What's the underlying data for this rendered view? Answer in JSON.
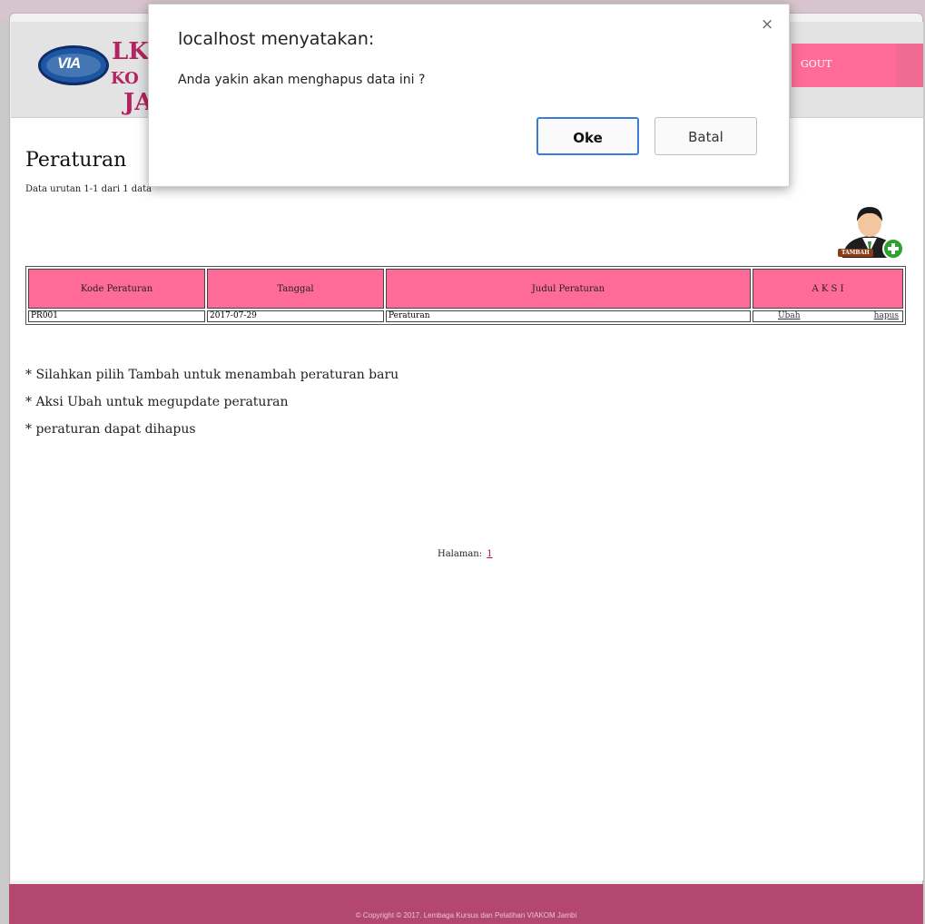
{
  "header": {
    "logo_text": "VIA",
    "brand_line1": "LK",
    "brand_line2": "KO",
    "brand_line3": "JA",
    "logout_label": "GOUT"
  },
  "page": {
    "title": "Peraturan",
    "data_info": "Data urutan 1-1 dari 1 data",
    "add_label": "TAMBAH"
  },
  "table": {
    "headers": [
      "Kode Peraturan",
      "Tanggal",
      "Judul Peraturan",
      "A K S I"
    ],
    "rows": [
      {
        "kode": "PR001",
        "tanggal": "2017-07-29",
        "judul": "Peraturan",
        "ubah": "Ubah",
        "hapus": "hapus"
      }
    ]
  },
  "notes": [
    "* Silahkan pilih Tambah untuk menambah peraturan baru",
    "* Aksi Ubah untuk megupdate peraturan",
    "* peraturan dapat dihapus"
  ],
  "pagination": {
    "label": "Halaman:",
    "current": "1"
  },
  "footer": {
    "text": "© Copyright © 2017. Lembaga Kursus dan Pelatihan VIAKOM Jambi"
  },
  "dialog": {
    "title": "localhost menyatakan:",
    "message": "Anda yakin akan menghapus data ini ?",
    "close": "×",
    "ok_label": "Oke",
    "cancel_label": "Batal"
  },
  "colors": {
    "accent_pink": "#ff6b99",
    "footer": "#b3476f",
    "brand": "#b32560",
    "dialog_ok_border": "#3b7bdc"
  }
}
